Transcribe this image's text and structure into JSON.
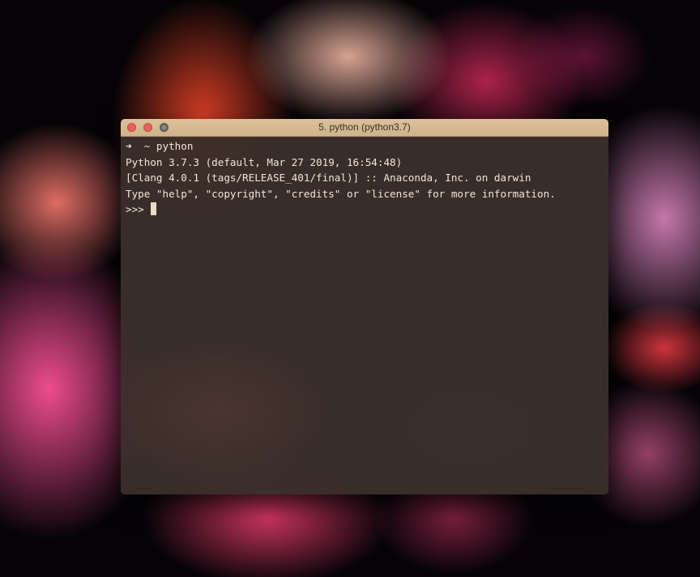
{
  "window": {
    "title": "5. python (python3.7)"
  },
  "terminal": {
    "prompt_arrow": "➜",
    "command_line": "  ~ python",
    "output": [
      "Python 3.7.3 (default, Mar 27 2019, 16:54:48)",
      "[Clang 4.0.1 (tags/RELEASE_401/final)] :: Anaconda, Inc. on darwin",
      "Type \"help\", \"copyright\", \"credits\" or \"license\" for more information."
    ],
    "repl_prompt": ">>> "
  },
  "colors": {
    "titlebar": "#d6ba93",
    "terminal_bg": "#3a2e2a",
    "terminal_text": "#f2e6d8"
  },
  "icons": {
    "close": "close-button",
    "minimize": "minimize-button",
    "zoom": "zoom-button"
  }
}
